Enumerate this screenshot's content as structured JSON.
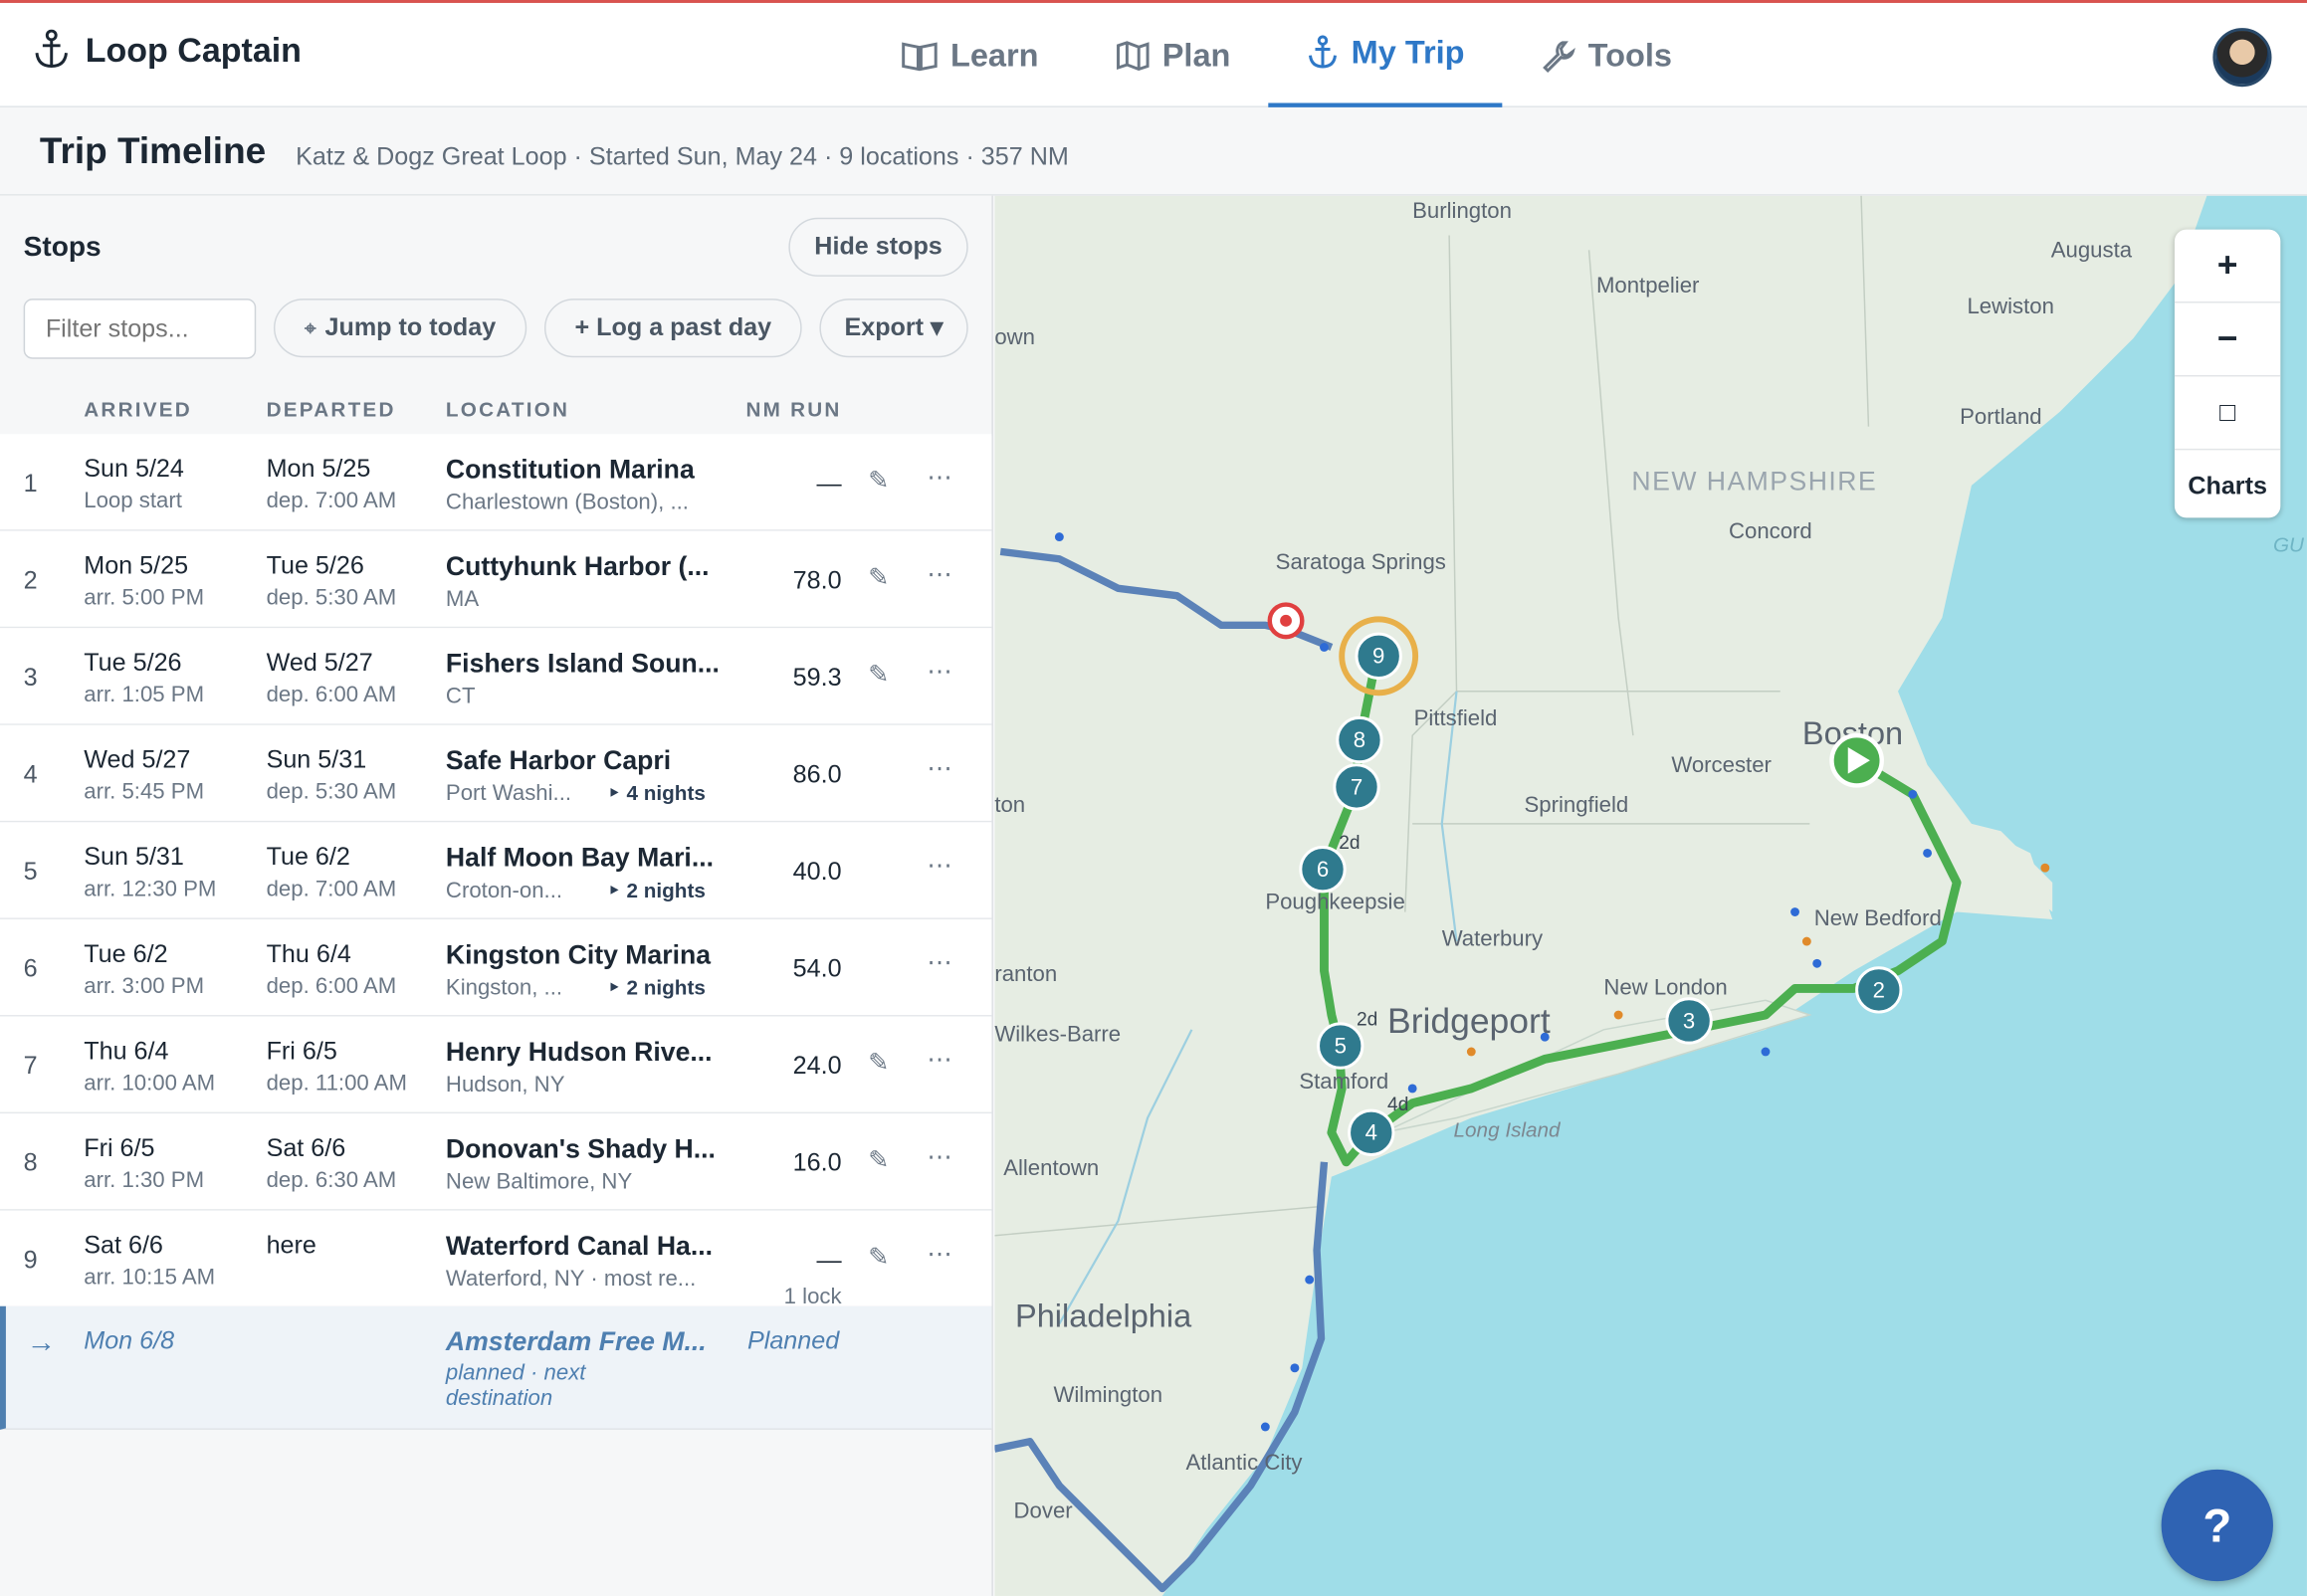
{
  "app": {
    "name": "Loop Captain"
  },
  "nav": [
    {
      "label": "Learn",
      "icon": "book-icon"
    },
    {
      "label": "Plan",
      "icon": "map-icon"
    },
    {
      "label": "My Trip",
      "icon": "anchor-icon",
      "active": true
    },
    {
      "label": "Tools",
      "icon": "wrench-icon"
    }
  ],
  "subheader": {
    "title": "Trip Timeline",
    "meta": "Katz & Dogz Great Loop · Started Sun, May 24 · 9 locations · 357 NM"
  },
  "panel": {
    "title": "Stops",
    "hide_label": "Hide stops",
    "filter_placeholder": "Filter stops...",
    "jump_label": "Jump to today",
    "log_label": "+ Log a past day",
    "export_label": "Export ▾",
    "columns": [
      "ARRIVED",
      "DEPARTED",
      "LOCATION",
      "NM RUN"
    ]
  },
  "rows": [
    {
      "idx": "1",
      "arr": "Sun 5/24",
      "arr_sub": "Loop start",
      "dep": "Mon 5/25",
      "dep_sub": "dep. 7:00 AM",
      "loc": "Constitution Marina",
      "loc_sub": "Charlestown (Boston), ...",
      "nights": "",
      "nm": "—",
      "nm_sub": ""
    },
    {
      "idx": "2",
      "arr": "Mon 5/25",
      "arr_sub": "arr. 5:00 PM",
      "dep": "Tue 5/26",
      "dep_sub": "dep. 5:30 AM",
      "loc": "Cuttyhunk Harbor (...",
      "loc_sub": "MA",
      "nights": "",
      "nm": "78.0",
      "nm_sub": ""
    },
    {
      "idx": "3",
      "arr": "Tue 5/26",
      "arr_sub": "arr. 1:05 PM",
      "dep": "Wed 5/27",
      "dep_sub": "dep. 6:00 AM",
      "loc": "Fishers Island Soun...",
      "loc_sub": "CT",
      "nights": "",
      "nm": "59.3",
      "nm_sub": ""
    },
    {
      "idx": "4",
      "arr": "Wed 5/27",
      "arr_sub": "arr. 5:45 PM",
      "dep": "Sun 5/31",
      "dep_sub": "dep. 5:30 AM",
      "loc": "Safe Harbor Capri",
      "loc_sub": "Port Washi...",
      "nights": "‣ 4 nights",
      "nm": "86.0",
      "nm_sub": ""
    },
    {
      "idx": "5",
      "arr": "Sun 5/31",
      "arr_sub": "arr. 12:30 PM",
      "dep": "Tue 6/2",
      "dep_sub": "dep. 7:00 AM",
      "loc": "Half Moon Bay Mari...",
      "loc_sub": "Croton-on...",
      "nights": "‣ 2 nights",
      "nm": "40.0",
      "nm_sub": ""
    },
    {
      "idx": "6",
      "arr": "Tue 6/2",
      "arr_sub": "arr. 3:00 PM",
      "dep": "Thu 6/4",
      "dep_sub": "dep. 6:00 AM",
      "loc": "Kingston City Marina",
      "loc_sub": "Kingston, ...",
      "nights": "‣ 2 nights",
      "nm": "54.0",
      "nm_sub": ""
    },
    {
      "idx": "7",
      "arr": "Thu 6/4",
      "arr_sub": "arr. 10:00 AM",
      "dep": "Fri 6/5",
      "dep_sub": "dep. 11:00 AM",
      "loc": "Henry Hudson Rive...",
      "loc_sub": "Hudson, NY",
      "nights": "",
      "nm": "24.0",
      "nm_sub": ""
    },
    {
      "idx": "8",
      "arr": "Fri 6/5",
      "arr_sub": "arr. 1:30 PM",
      "dep": "Sat 6/6",
      "dep_sub": "dep. 6:30 AM",
      "loc": "Donovan's Shady H...",
      "loc_sub": "New Baltimore, NY",
      "nights": "",
      "nm": "16.0",
      "nm_sub": ""
    },
    {
      "idx": "9",
      "arr": "Sat 6/6",
      "arr_sub": "arr. 10:15 AM",
      "dep": "here",
      "dep_sub": "",
      "loc": "Waterford Canal Ha...",
      "loc_sub": "Waterford, NY · most re...",
      "nights": "",
      "nm": "—",
      "nm_sub": "1 lock"
    }
  ],
  "planned": {
    "date": "Mon 6/8",
    "loc": "Amsterdam Free M...",
    "sub": "planned · next",
    "sub2": "destination",
    "status": "Planned"
  },
  "map": {
    "labels": [
      "Burlington",
      "Montpelier",
      "Augusta",
      "Lewiston",
      "Portland",
      "NEW HAMPSHIRE",
      "Concord",
      "Saratoga Springs",
      "Pittsfield",
      "Boston",
      "Worcester",
      "Springfield",
      "Waterbury",
      "New London",
      "New Bedford",
      "Bridgeport",
      "Stamford",
      "Poughkeepsie",
      "Long Island",
      "Wilkes-Barre",
      "Allentown",
      "Philadelphia",
      "Wilmington",
      "Atlantic City",
      "Dover",
      "GU",
      "ton",
      "own",
      "ranton"
    ],
    "markers": [
      "9",
      "8",
      "7",
      "6",
      "5",
      "4",
      "3",
      "2"
    ],
    "stay_labels": [
      "2d",
      "2d",
      "4d"
    ],
    "charts_label": "Charts",
    "zoom_in": "+",
    "zoom_out": "−",
    "fullscreen": "□",
    "help": "?"
  },
  "colors": {
    "accent": "#2e78c7",
    "route_done": "#4caf50",
    "route_planned": "#5b82b8",
    "water": "#9fdde8",
    "land": "#e8efe6"
  }
}
